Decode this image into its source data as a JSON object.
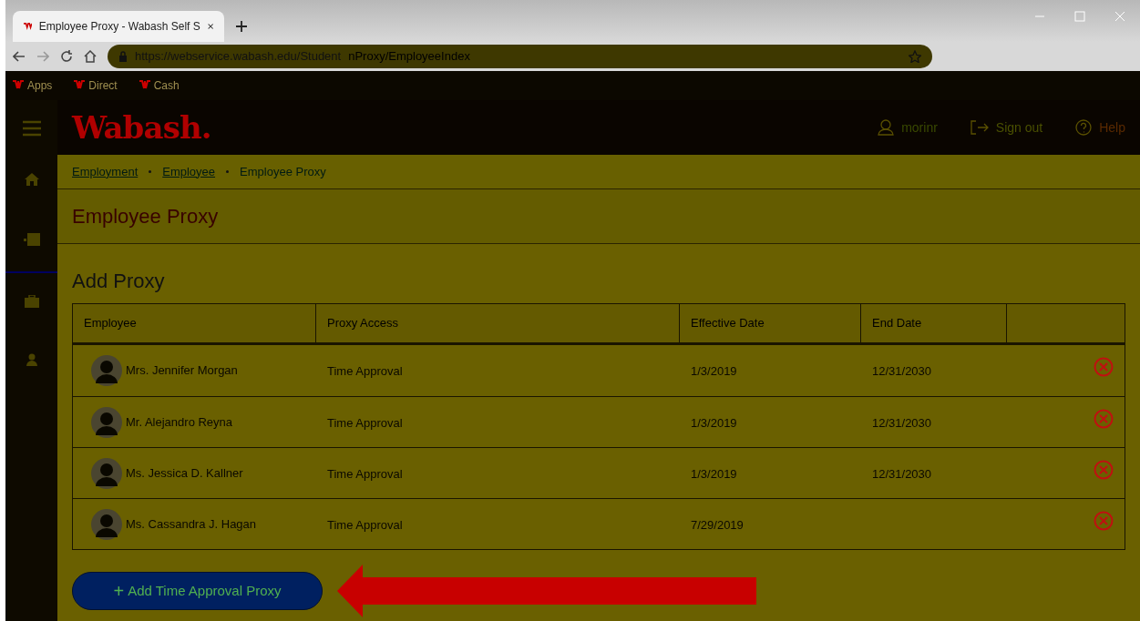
{
  "browser": {
    "tab_title": "Employee Proxy - Wabash Self S",
    "url_base": "https://webservice.wabash.edu/Student",
    "url_rest": "nProxy/EmployeeIndex",
    "bookmarks": [
      {
        "label": "Apps"
      },
      {
        "label": "Direct"
      },
      {
        "label": "Cash"
      }
    ]
  },
  "header": {
    "logo": "Wabash.",
    "user": "morinr",
    "sign_out": "Sign out",
    "help": "Help"
  },
  "breadcrumb": [
    {
      "label": "Employment",
      "link": true
    },
    {
      "label": "Employee",
      "link": true
    },
    {
      "label": "Employee Proxy",
      "link": false
    }
  ],
  "page_title": "Employee Proxy",
  "section_title": "Add Proxy",
  "table": {
    "columns": [
      "Employee",
      "Proxy Access",
      "Effective Date",
      "End Date"
    ],
    "rows": [
      {
        "employee": "Mrs. Jennifer Morgan",
        "access": "Time Approval",
        "effective": "1/3/2019",
        "end": "12/31/2030"
      },
      {
        "employee": "Mr. Alejandro Reyna",
        "access": "Time Approval",
        "effective": "1/3/2019",
        "end": "12/31/2030"
      },
      {
        "employee": "Ms. Jessica D. Kallner",
        "access": "Time Approval",
        "effective": "1/3/2019",
        "end": "12/31/2030"
      },
      {
        "employee": "Ms. Cassandra J. Hagan",
        "access": "Time Approval",
        "effective": "7/29/2019"
      }
    ]
  },
  "add_button": {
    "icon": "+",
    "label": "Add Time Approval Proxy"
  }
}
